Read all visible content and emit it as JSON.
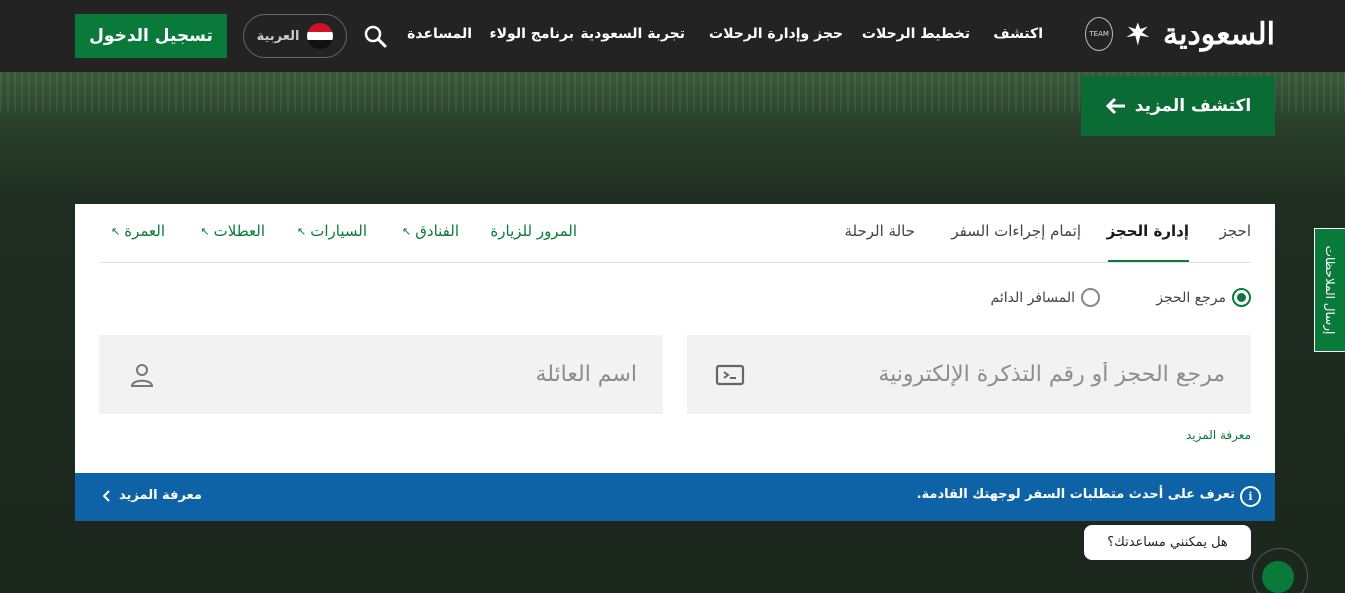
{
  "header": {
    "logo_text": "السعودية",
    "nav": {
      "discover": "اكتشف",
      "plan": "تخطيط الرحلات",
      "book": "حجز وإدارة الرحلات",
      "experience": "تجربة السعودية",
      "loyalty": "برنامج الولاء",
      "help": "المساعدة"
    },
    "language": "العربية",
    "login": "تسجيل الدخول"
  },
  "hero": {
    "discover_more": "اكتشف المزيد"
  },
  "feedback": "إرسال الملاحظات",
  "booking": {
    "tabs": {
      "book": "احجز",
      "manage": "إدارة الحجز",
      "checkin": "إتمام إجراءات السفر",
      "status": "حالة الرحلة"
    },
    "links": {
      "transit": "المرور للزيارة",
      "hotels": "الفنادق",
      "cars": "السيارات",
      "holidays": "العطلات",
      "umrah": "العمرة"
    },
    "radio": {
      "ref": "مرجع الحجز",
      "ff": "المسافر الدائم"
    },
    "fields": {
      "ref_placeholder": "مرجع الحجز أو رقم التذكرة الإلكترونية",
      "name_placeholder": "اسم العائلة"
    },
    "learn_more": "معرفة المزيد"
  },
  "infobar": {
    "text": "تعرف على أحدث متطلبات السفر لوجهتك القادمة.",
    "more": "معرفة المزيد"
  },
  "chat": {
    "bubble": "هل يمكنني مساعدتك؟"
  },
  "colors": {
    "brand_green": "#0a7a3a",
    "info_blue": "#0d63a5",
    "header_bg": "#232323"
  }
}
